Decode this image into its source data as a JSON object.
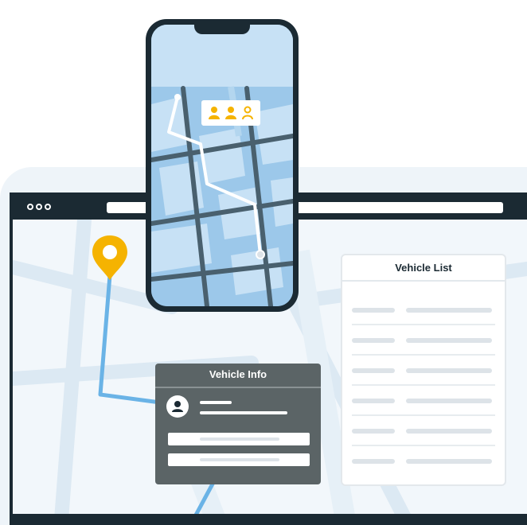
{
  "vehicle_list": {
    "title": "Vehicle List",
    "row_count": 6
  },
  "vehicle_info": {
    "title": "Vehicle Info"
  },
  "colors": {
    "dark": "#1b2a33",
    "accent_pin": "#f5b301",
    "route_blue": "#6ab3e6",
    "phone_map": "#9cc8ea",
    "passenger": "#f5b301"
  },
  "icons": [
    "location-pin-icon",
    "user-icon",
    "passenger-icon"
  ],
  "phone": {
    "passengers_filled": 2,
    "passengers_outline": 1
  }
}
